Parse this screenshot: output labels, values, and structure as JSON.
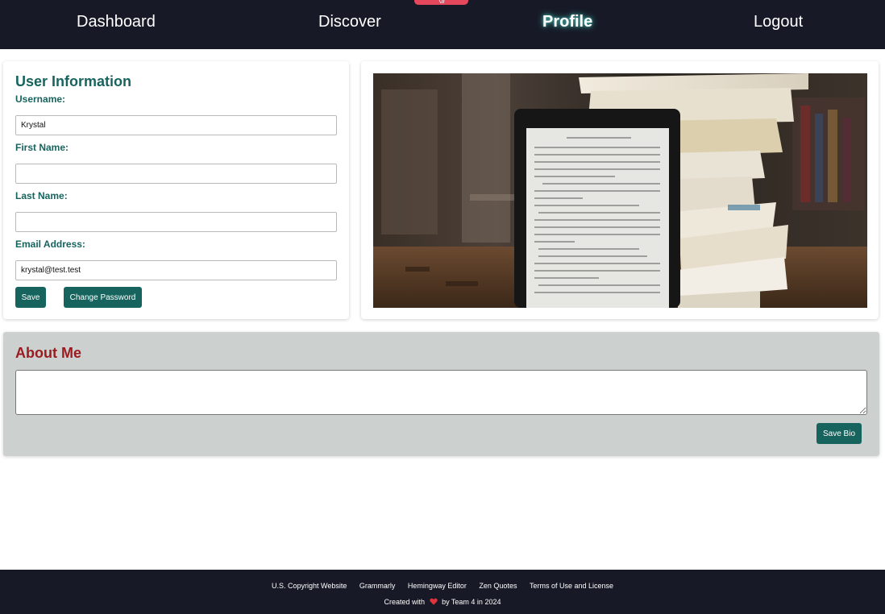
{
  "nav": {
    "items": [
      {
        "label": "Dashboard"
      },
      {
        "label": "Discover"
      },
      {
        "label": "Profile"
      },
      {
        "label": "Logout"
      }
    ],
    "active": "Profile",
    "tab_color": "#e5485d"
  },
  "user_info": {
    "title": "User Information",
    "username_label": "Username:",
    "username_value": "Krystal",
    "first_name_label": "First Name:",
    "first_name_value": "",
    "last_name_label": "Last Name:",
    "last_name_value": "",
    "email_label": "Email Address:",
    "email_value": "krystal@test.test",
    "save_label": "Save",
    "change_password_label": "Change Password"
  },
  "about": {
    "title": "About Me",
    "bio_value": "",
    "save_bio_label": "Save Bio"
  },
  "footer": {
    "links": [
      {
        "label": "U.S. Copyright Website"
      },
      {
        "label": "Grammarly"
      },
      {
        "label": "Hemingway Editor"
      },
      {
        "label": "Zen Quotes"
      },
      {
        "label": "Terms of Use and License"
      }
    ],
    "credit_prefix": "Created with",
    "credit_icon": "heart-icon",
    "credit_suffix": "by Team 4 in 2024"
  },
  "colors": {
    "nav_bg": "#171a26",
    "accent": "#17645e",
    "about_title": "#9b1c20",
    "about_bg": "#ccd1cf",
    "heart": "#e0333c"
  }
}
